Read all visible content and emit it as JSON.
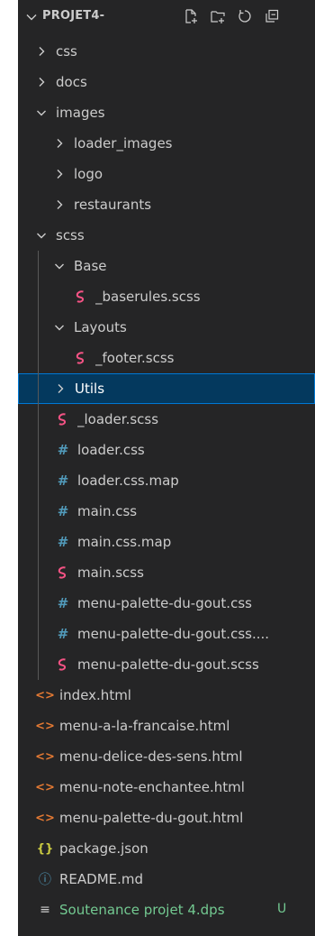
{
  "explorer": {
    "title": "PROJET4-",
    "actions": [
      {
        "name": "new-file-icon"
      },
      {
        "name": "new-folder-icon"
      },
      {
        "name": "refresh-icon"
      },
      {
        "name": "collapse-all-icon"
      }
    ],
    "items": [
      {
        "label": "css",
        "type": "folder",
        "expanded": false,
        "depth": 1
      },
      {
        "label": "docs",
        "type": "folder",
        "expanded": false,
        "depth": 1
      },
      {
        "label": "images",
        "type": "folder",
        "expanded": true,
        "depth": 1
      },
      {
        "label": "loader_images",
        "type": "folder",
        "expanded": false,
        "depth": 2
      },
      {
        "label": "logo",
        "type": "folder",
        "expanded": false,
        "depth": 2
      },
      {
        "label": "restaurants",
        "type": "folder",
        "expanded": false,
        "depth": 2
      },
      {
        "label": "scss",
        "type": "folder",
        "expanded": true,
        "depth": 1
      },
      {
        "label": "Base",
        "type": "folder",
        "expanded": true,
        "depth": 2
      },
      {
        "label": "_baserules.scss",
        "type": "scss",
        "depth": 3
      },
      {
        "label": "Layouts",
        "type": "folder",
        "expanded": true,
        "depth": 2
      },
      {
        "label": "_footer.scss",
        "type": "scss",
        "depth": 3
      },
      {
        "label": "Utils",
        "type": "folder",
        "expanded": false,
        "depth": 2,
        "selected": true
      },
      {
        "label": "_loader.scss",
        "type": "scss",
        "depth": 2
      },
      {
        "label": "loader.css",
        "type": "css",
        "depth": 2
      },
      {
        "label": "loader.css.map",
        "type": "css",
        "depth": 2
      },
      {
        "label": "main.css",
        "type": "css",
        "depth": 2
      },
      {
        "label": "main.css.map",
        "type": "css",
        "depth": 2
      },
      {
        "label": "main.scss",
        "type": "scss",
        "depth": 2
      },
      {
        "label": "menu-palette-du-gout.css",
        "type": "css",
        "depth": 2
      },
      {
        "label": "menu-palette-du-gout.css....",
        "type": "css",
        "depth": 2
      },
      {
        "label": "menu-palette-du-gout.scss",
        "type": "scss",
        "depth": 2
      },
      {
        "label": "index.html",
        "type": "html",
        "depth": 1
      },
      {
        "label": "menu-a-la-francaise.html",
        "type": "html",
        "depth": 1
      },
      {
        "label": "menu-delice-des-sens.html",
        "type": "html",
        "depth": 1
      },
      {
        "label": "menu-note-enchantee.html",
        "type": "html",
        "depth": 1
      },
      {
        "label": "menu-palette-du-gout.html",
        "type": "html",
        "depth": 1
      },
      {
        "label": "package.json",
        "type": "json",
        "depth": 1
      },
      {
        "label": "README.md",
        "type": "info",
        "depth": 1
      },
      {
        "label": "Soutenance projet 4.dps",
        "type": "text",
        "depth": 1,
        "git_status": "U"
      }
    ]
  },
  "colors": {
    "background": "#252526",
    "text": "#cccccc",
    "selection_bg": "#04395e",
    "selection_border": "#0078d4",
    "scss": "#f55385",
    "css": "#519aba",
    "html": "#e37933",
    "json": "#cbcb41",
    "git_untracked": "#73c991"
  }
}
